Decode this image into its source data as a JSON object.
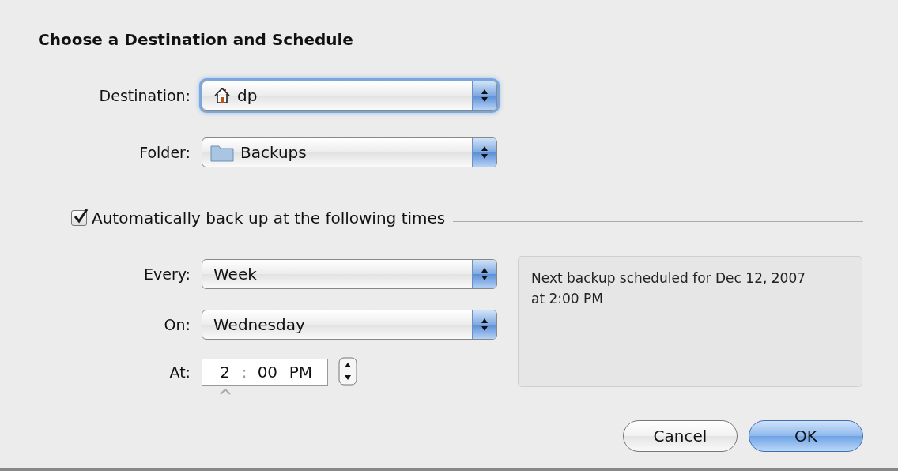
{
  "title": "Choose a Destination and Schedule",
  "location": [
    {
      "label": "Destination:",
      "value": "dp",
      "focused": true
    },
    {
      "label": "Folder:",
      "value": "Backups",
      "focused": false
    }
  ],
  "auto_backup": {
    "label": "Automatically back up at the following times",
    "checked": true
  },
  "schedule": [
    {
      "label": "Every:",
      "value": "Week",
      "focused": false
    },
    {
      "label": "On:",
      "value": "Wednesday",
      "focused": false
    }
  ],
  "time": {
    "label": "At:",
    "segments": [
      {
        "text": "2",
        "selected": true
      },
      {
        "text": "00",
        "selected": false
      },
      {
        "text": "PM",
        "selected": false
      }
    ],
    "separator": ":"
  },
  "next_backup": "Next backup scheduled for Dec 12, 2007 at 2:00 PM",
  "buttons": [
    {
      "label": "Cancel",
      "default": false
    },
    {
      "label": "OK",
      "default": true
    }
  ]
}
